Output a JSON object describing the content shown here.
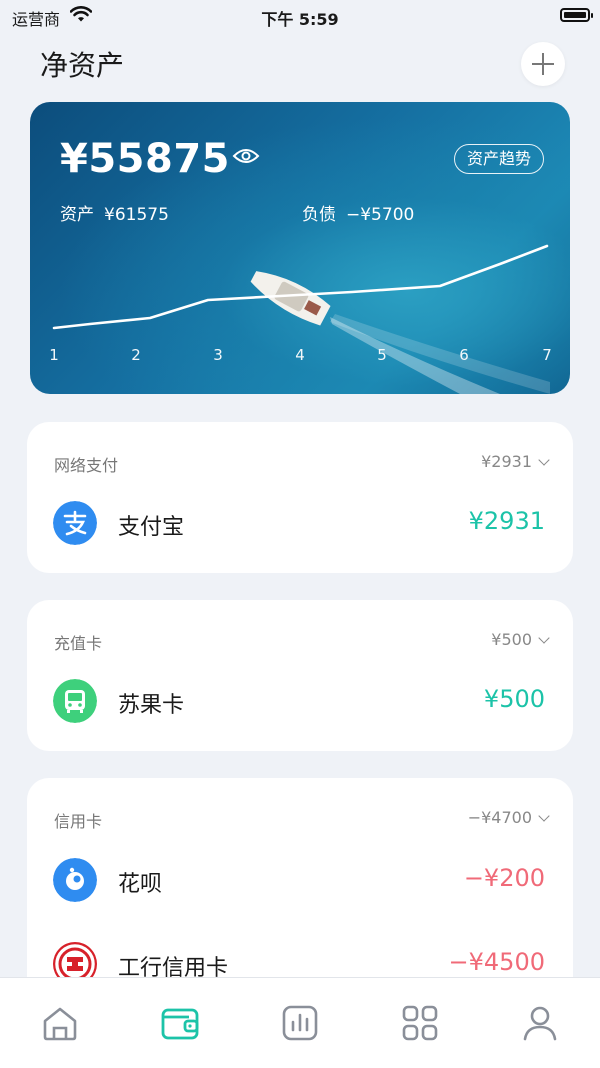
{
  "status_bar": {
    "carrier": "运营商",
    "time": "下午 5:59"
  },
  "header": {
    "title": "净资产"
  },
  "hero": {
    "net_worth": "¥55875",
    "trend_button": "资产趋势",
    "assets_label": "资产",
    "assets_value": "¥61575",
    "debt_label": "负债",
    "debt_value": "−¥5700",
    "chart_x": [
      "1",
      "2",
      "3",
      "4",
      "5",
      "6",
      "7"
    ]
  },
  "groups": [
    {
      "label": "网络支付",
      "total": "¥2931",
      "items": [
        {
          "name": "支付宝",
          "amount": "¥2931",
          "icon": "alipay-icon",
          "color": "#2f8cf0"
        }
      ]
    },
    {
      "label": "充值卡",
      "total": "¥500",
      "items": [
        {
          "name": "苏果卡",
          "amount": "¥500",
          "icon": "bus-card-icon",
          "color": "#3ed07c"
        }
      ]
    },
    {
      "label": "信用卡",
      "total": "−¥4700",
      "items": [
        {
          "name": "花呗",
          "amount": "−¥200",
          "icon": "huabei-icon",
          "color": "#2f8cf0"
        },
        {
          "name": "工行信用卡",
          "amount": "−¥4500",
          "icon": "icbc-icon",
          "color": "#d7212a"
        }
      ]
    }
  ],
  "tabbar": {
    "tabs": [
      {
        "name": "home",
        "icon": "home-icon"
      },
      {
        "name": "wallet",
        "icon": "wallet-icon",
        "active": true
      },
      {
        "name": "stats",
        "icon": "bar-chart-icon"
      },
      {
        "name": "apps",
        "icon": "grid-icon"
      },
      {
        "name": "profile",
        "icon": "user-icon"
      }
    ],
    "active_color": "#1cc3a8"
  }
}
